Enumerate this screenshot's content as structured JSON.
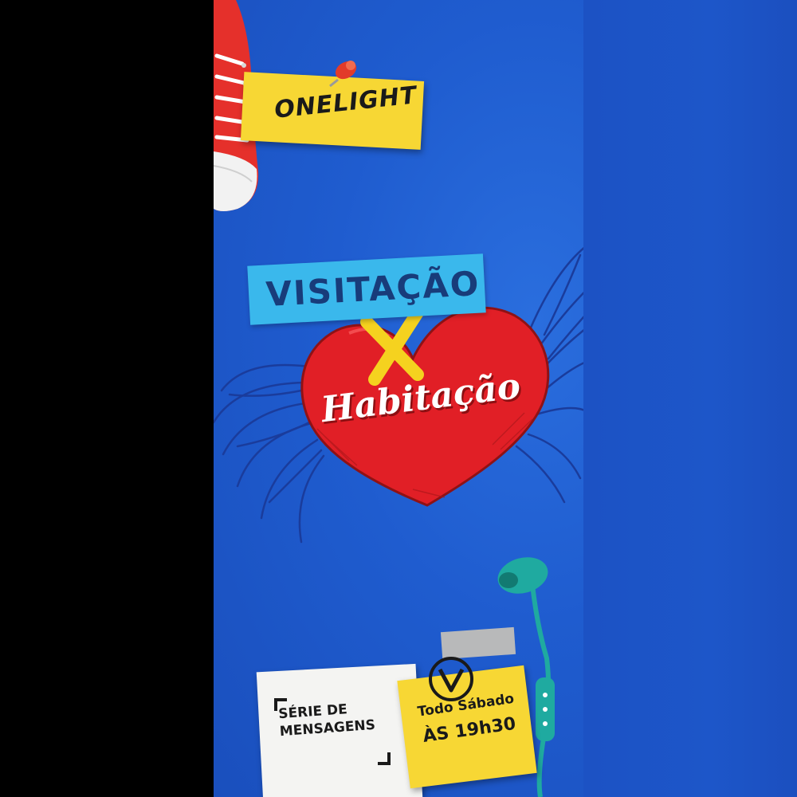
{
  "logo": {
    "text": "ONELIGHT"
  },
  "title": {
    "tape": "VISITAÇÃO",
    "heart": "Habitação"
  },
  "notes": {
    "serie": {
      "line1": "SÉRIE DE",
      "line2": "MENSAGENS"
    },
    "schedule": {
      "line1": "Todo Sábado",
      "line2": "ÀS 19h30"
    }
  },
  "colors": {
    "background": "#1f5ccf",
    "sticky_yellow": "#f7d734",
    "tape_blue": "#3ab8ec",
    "heart_red": "#e11f26",
    "cross_yellow": "#f5d21f",
    "wings_line": "#1a3c9c",
    "earphone_teal": "#1faaa0",
    "sneaker_red": "#e5302b"
  },
  "icons": [
    "sneaker-icon",
    "pushpin-icon",
    "wings-icon",
    "heart-icon",
    "cross-icon",
    "earphones-icon",
    "v-logo-icon"
  ]
}
